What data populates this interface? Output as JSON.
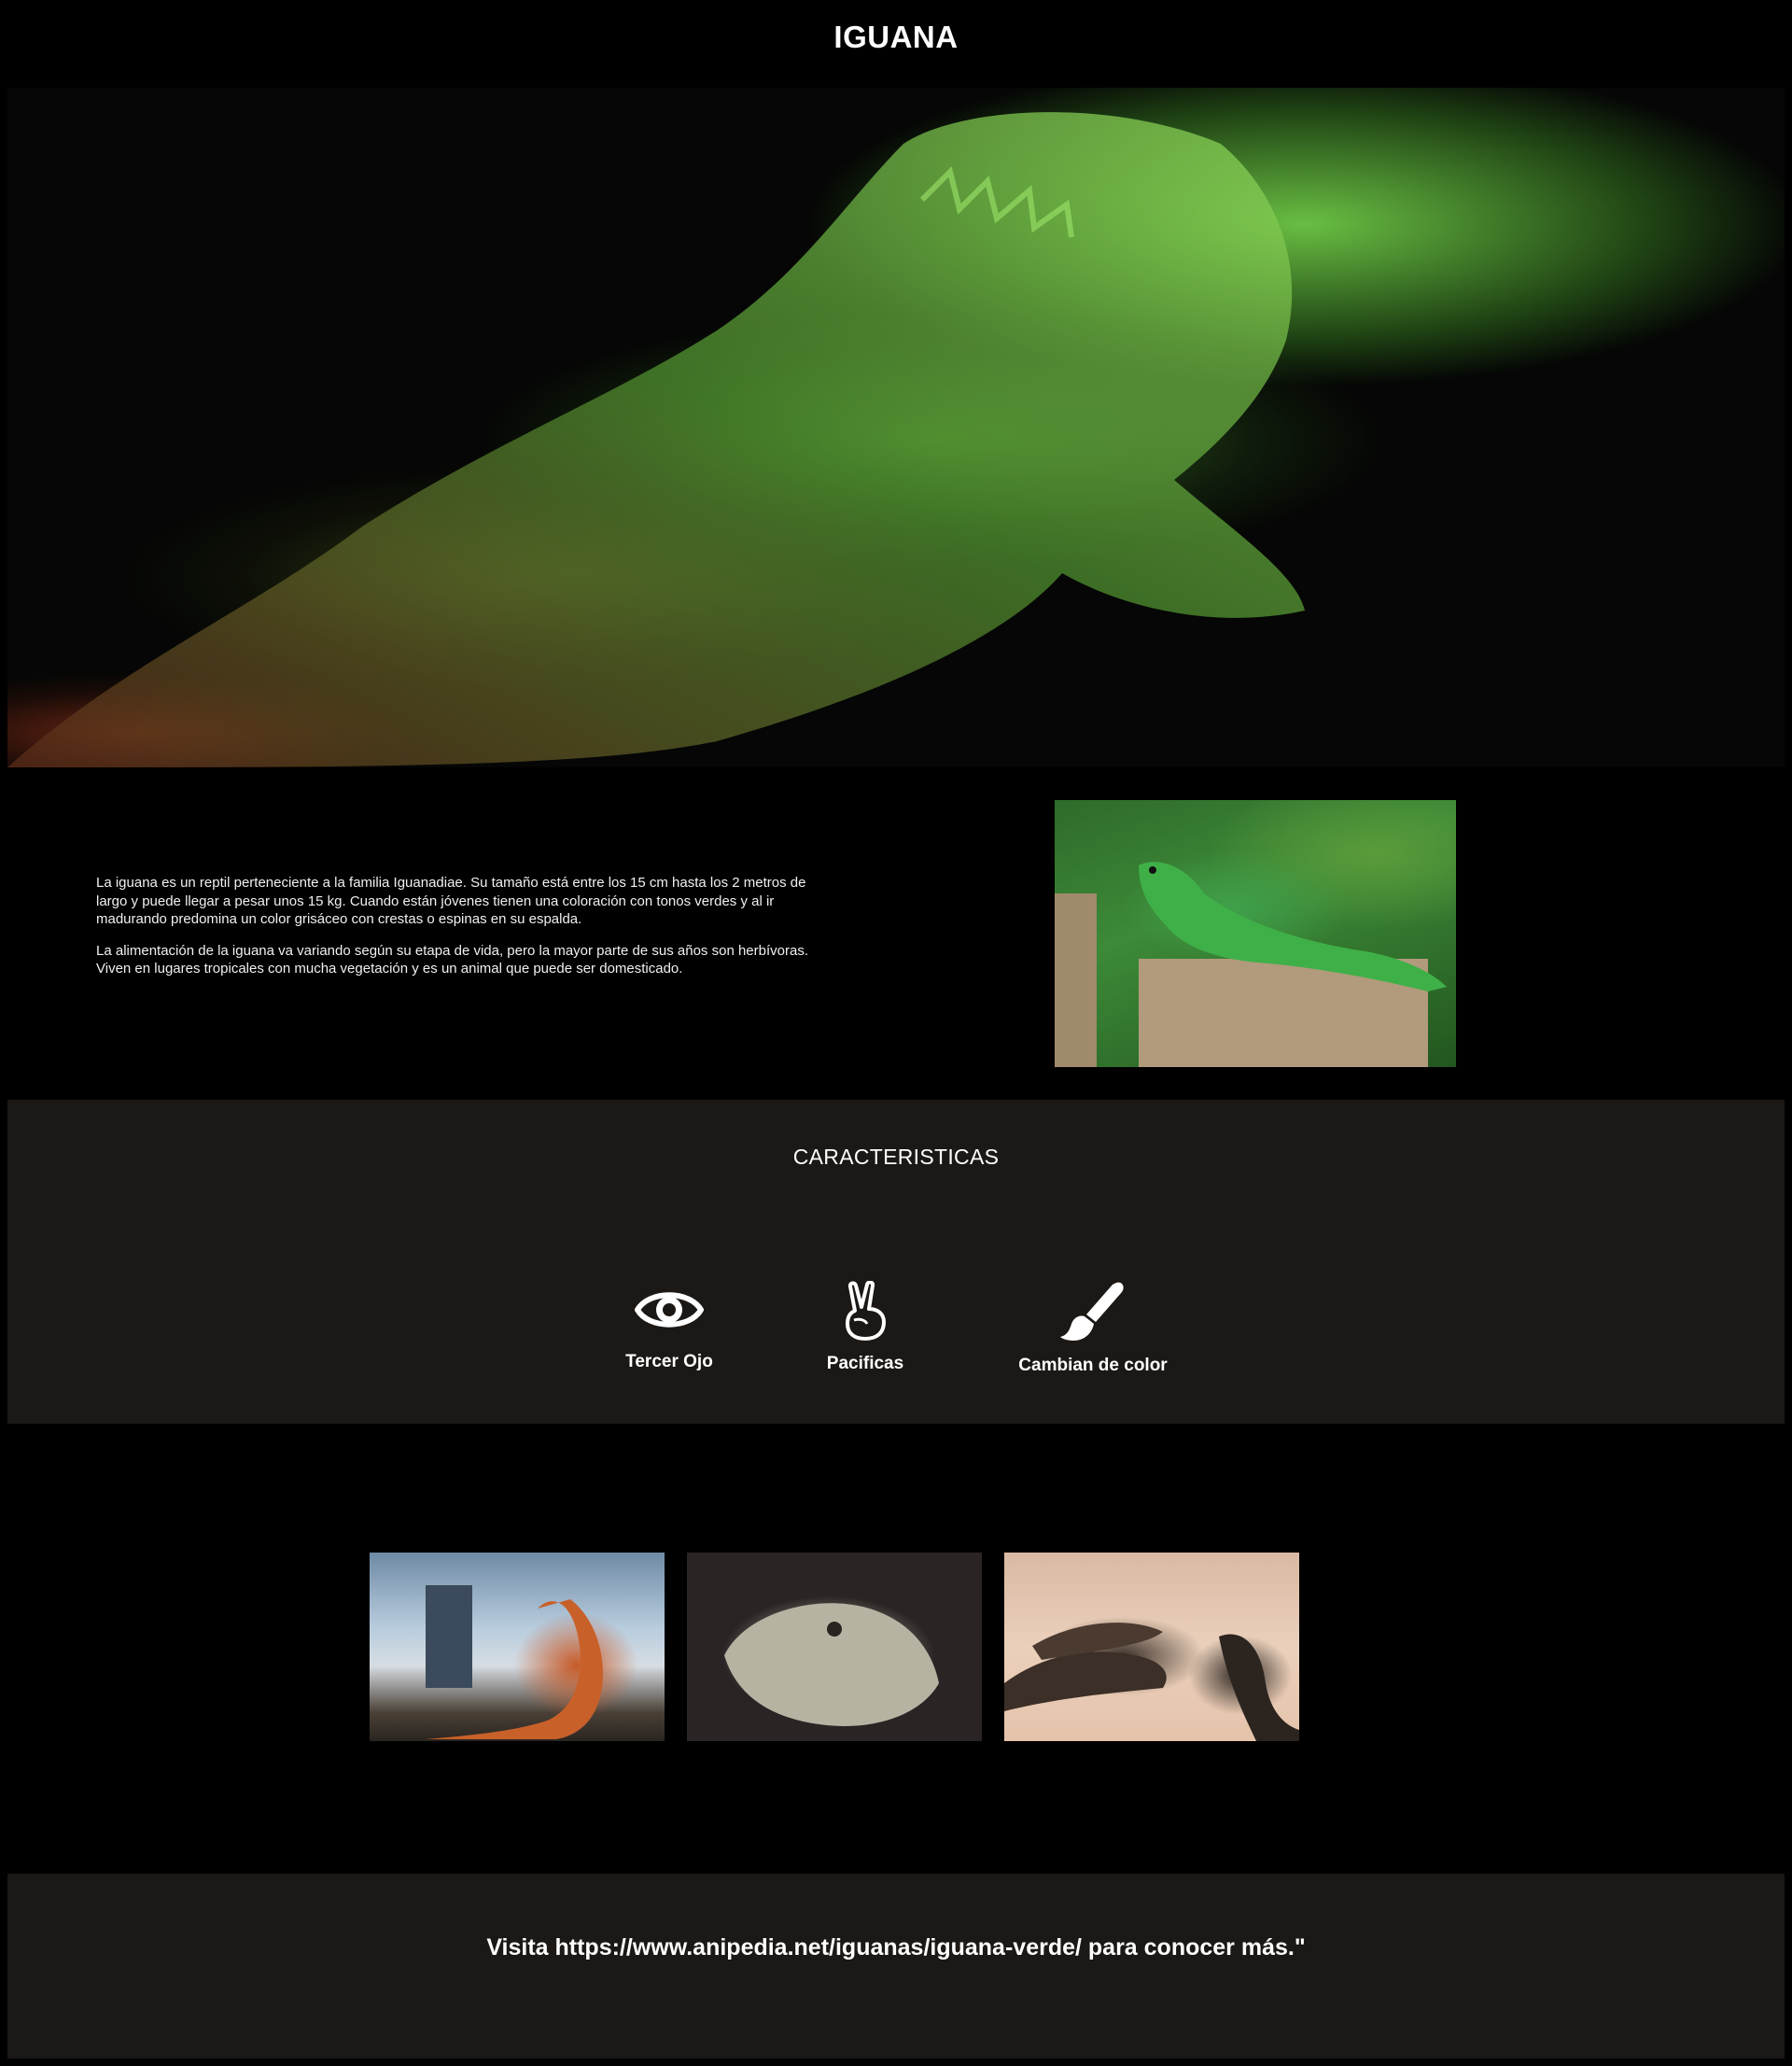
{
  "header": {
    "title": "IGUANA"
  },
  "hero": {
    "alt": "Green bearded lizard on dark background"
  },
  "intro": {
    "paragraphs": [
      "La iguana es un reptil perteneciente a la familia Iguanadiae. Su tamaño está entre los 15 cm hasta los 2 metros de largo y puede llegar a pesar unos 15 kg. Cuando están jóvenes tienen una coloración con tonos verdes y al ir madurando predomina un color grisáceo con crestas o espinas en su espalda.",
      "La alimentación de la iguana va variando según su etapa de vida, pero la mayor parte de sus años son herbívoras. Viven en lugares tropicales con mucha vegetación y es un animal que puede ser domesticado."
    ]
  },
  "features": {
    "title": "CARACTERISTICAS",
    "items": [
      {
        "icon": "eye-icon",
        "label": "Tercer Ojo"
      },
      {
        "icon": "peace-hand-icon",
        "label": "Pacificas"
      },
      {
        "icon": "paint-brush-icon",
        "label": "Cambian de color"
      }
    ]
  },
  "footer": {
    "text": "Visita https://www.anipedia.net/iguanas/iguana-verde/ para conocer más.\""
  },
  "colors": {
    "page_bg": "#000000",
    "section_bg": "#1b1815",
    "text": "#ffffff"
  }
}
